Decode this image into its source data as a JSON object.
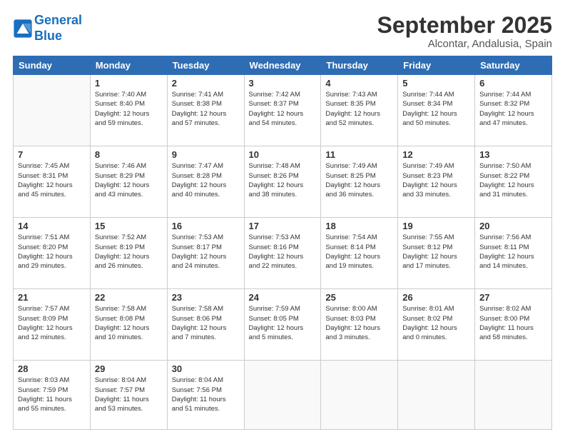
{
  "header": {
    "logo_line1": "General",
    "logo_line2": "Blue",
    "month": "September 2025",
    "location": "Alcontar, Andalusia, Spain"
  },
  "weekdays": [
    "Sunday",
    "Monday",
    "Tuesday",
    "Wednesday",
    "Thursday",
    "Friday",
    "Saturday"
  ],
  "weeks": [
    [
      {
        "day": "",
        "info": ""
      },
      {
        "day": "1",
        "info": "Sunrise: 7:40 AM\nSunset: 8:40 PM\nDaylight: 12 hours\nand 59 minutes."
      },
      {
        "day": "2",
        "info": "Sunrise: 7:41 AM\nSunset: 8:38 PM\nDaylight: 12 hours\nand 57 minutes."
      },
      {
        "day": "3",
        "info": "Sunrise: 7:42 AM\nSunset: 8:37 PM\nDaylight: 12 hours\nand 54 minutes."
      },
      {
        "day": "4",
        "info": "Sunrise: 7:43 AM\nSunset: 8:35 PM\nDaylight: 12 hours\nand 52 minutes."
      },
      {
        "day": "5",
        "info": "Sunrise: 7:44 AM\nSunset: 8:34 PM\nDaylight: 12 hours\nand 50 minutes."
      },
      {
        "day": "6",
        "info": "Sunrise: 7:44 AM\nSunset: 8:32 PM\nDaylight: 12 hours\nand 47 minutes."
      }
    ],
    [
      {
        "day": "7",
        "info": "Sunrise: 7:45 AM\nSunset: 8:31 PM\nDaylight: 12 hours\nand 45 minutes."
      },
      {
        "day": "8",
        "info": "Sunrise: 7:46 AM\nSunset: 8:29 PM\nDaylight: 12 hours\nand 43 minutes."
      },
      {
        "day": "9",
        "info": "Sunrise: 7:47 AM\nSunset: 8:28 PM\nDaylight: 12 hours\nand 40 minutes."
      },
      {
        "day": "10",
        "info": "Sunrise: 7:48 AM\nSunset: 8:26 PM\nDaylight: 12 hours\nand 38 minutes."
      },
      {
        "day": "11",
        "info": "Sunrise: 7:49 AM\nSunset: 8:25 PM\nDaylight: 12 hours\nand 36 minutes."
      },
      {
        "day": "12",
        "info": "Sunrise: 7:49 AM\nSunset: 8:23 PM\nDaylight: 12 hours\nand 33 minutes."
      },
      {
        "day": "13",
        "info": "Sunrise: 7:50 AM\nSunset: 8:22 PM\nDaylight: 12 hours\nand 31 minutes."
      }
    ],
    [
      {
        "day": "14",
        "info": "Sunrise: 7:51 AM\nSunset: 8:20 PM\nDaylight: 12 hours\nand 29 minutes."
      },
      {
        "day": "15",
        "info": "Sunrise: 7:52 AM\nSunset: 8:19 PM\nDaylight: 12 hours\nand 26 minutes."
      },
      {
        "day": "16",
        "info": "Sunrise: 7:53 AM\nSunset: 8:17 PM\nDaylight: 12 hours\nand 24 minutes."
      },
      {
        "day": "17",
        "info": "Sunrise: 7:53 AM\nSunset: 8:16 PM\nDaylight: 12 hours\nand 22 minutes."
      },
      {
        "day": "18",
        "info": "Sunrise: 7:54 AM\nSunset: 8:14 PM\nDaylight: 12 hours\nand 19 minutes."
      },
      {
        "day": "19",
        "info": "Sunrise: 7:55 AM\nSunset: 8:12 PM\nDaylight: 12 hours\nand 17 minutes."
      },
      {
        "day": "20",
        "info": "Sunrise: 7:56 AM\nSunset: 8:11 PM\nDaylight: 12 hours\nand 14 minutes."
      }
    ],
    [
      {
        "day": "21",
        "info": "Sunrise: 7:57 AM\nSunset: 8:09 PM\nDaylight: 12 hours\nand 12 minutes."
      },
      {
        "day": "22",
        "info": "Sunrise: 7:58 AM\nSunset: 8:08 PM\nDaylight: 12 hours\nand 10 minutes."
      },
      {
        "day": "23",
        "info": "Sunrise: 7:58 AM\nSunset: 8:06 PM\nDaylight: 12 hours\nand 7 minutes."
      },
      {
        "day": "24",
        "info": "Sunrise: 7:59 AM\nSunset: 8:05 PM\nDaylight: 12 hours\nand 5 minutes."
      },
      {
        "day": "25",
        "info": "Sunrise: 8:00 AM\nSunset: 8:03 PM\nDaylight: 12 hours\nand 3 minutes."
      },
      {
        "day": "26",
        "info": "Sunrise: 8:01 AM\nSunset: 8:02 PM\nDaylight: 12 hours\nand 0 minutes."
      },
      {
        "day": "27",
        "info": "Sunrise: 8:02 AM\nSunset: 8:00 PM\nDaylight: 11 hours\nand 58 minutes."
      }
    ],
    [
      {
        "day": "28",
        "info": "Sunrise: 8:03 AM\nSunset: 7:59 PM\nDaylight: 11 hours\nand 55 minutes."
      },
      {
        "day": "29",
        "info": "Sunrise: 8:04 AM\nSunset: 7:57 PM\nDaylight: 11 hours\nand 53 minutes."
      },
      {
        "day": "30",
        "info": "Sunrise: 8:04 AM\nSunset: 7:56 PM\nDaylight: 11 hours\nand 51 minutes."
      },
      {
        "day": "",
        "info": ""
      },
      {
        "day": "",
        "info": ""
      },
      {
        "day": "",
        "info": ""
      },
      {
        "day": "",
        "info": ""
      }
    ]
  ]
}
